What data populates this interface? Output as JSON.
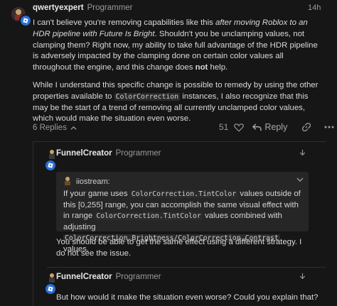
{
  "post1": {
    "username": "qwertyexpert",
    "role": "Programmer",
    "time": "14h",
    "p1_a": "I can't believe you're removing capabilities like this ",
    "p1_em": "after moving Roblox to an HDR pipeline with Future Is Bright",
    "p1_b": ". Shouldn't you be unclamping values, not clamping them? Right now, my ability to take full advantage of the HDR pipeline is adversely impacted by the clamping done on certain color values all throughout the engine, and this change does ",
    "p1_strong": "not",
    "p1_c": " help.",
    "p2_a": "While I understand this specific change is possible to remedy by using the other properties available to ",
    "p2_code": "ColorCorrection",
    "p2_b": " instances, I also recognize that this may be the start of a trend of removing all currently unclamped color values, which would make the situation even worse.",
    "replies_label": "6 Replies",
    "likes": "51",
    "reply_label": "Reply"
  },
  "post2": {
    "username": "FunnelCreator",
    "role": "Programmer",
    "quote": {
      "author": "iiostream:",
      "t1": "If your game uses ",
      "c1": "ColorCorrection.TintColor",
      "t2": " values outside of this [0,255] range, you can accomplish the same visual effect with in range ",
      "c2": "ColorCorrection.TintColor",
      "t3": " values combined with adjusting ",
      "c3": "ColorCorrection.Brightness/ColorCorrection.Contrast",
      "t4": " values."
    },
    "text": "You should be able to get the same effect using a different strategy. I do not see the issue."
  },
  "post3": {
    "username": "FunnelCreator",
    "role": "Programmer",
    "text": "But how would it make the situation even worse? Could you explain that?"
  },
  "colors": {
    "badge": "#2a6fd6",
    "background": "#161616",
    "quote_bg": "#262626"
  },
  "icons": [
    "roblox-badge-icon",
    "chevron-up-icon",
    "heart-icon",
    "reply-arrow-icon",
    "link-icon",
    "more-icon",
    "chevron-down-icon"
  ]
}
